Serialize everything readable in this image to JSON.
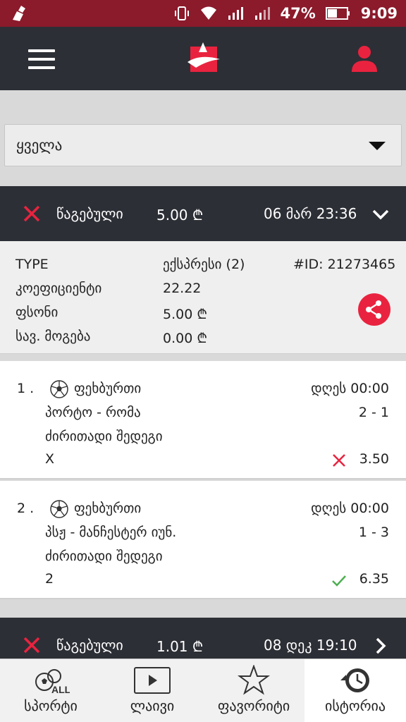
{
  "status_bar": {
    "battery": "47%",
    "time": "9:09"
  },
  "filter": {
    "value": "ყველა"
  },
  "ticket1": {
    "status": "წაგებული",
    "amount": "5.00 ₾",
    "date": "06 მარ 23:36",
    "details": {
      "type_label": "TYPE",
      "type_value": "ექსპრესი (2)",
      "id": "#ID: 21273465",
      "coef_label": "კოეფიციენტი",
      "coef_value": "22.22",
      "stake_label": "ფსონი",
      "stake_value": "5.00 ₾",
      "win_label": "სავ. მოგება",
      "win_value": "0.00 ₾"
    },
    "selections": [
      {
        "num": "1 .",
        "sport": "ფეხბურთი",
        "time": "დღეს 00:00",
        "match": "პორტო - რომა",
        "score": "2 - 1",
        "market": "ძირითადი შედეგი",
        "pick": "X",
        "result": "lost",
        "odd": "3.50"
      },
      {
        "num": "2 .",
        "sport": "ფეხბურთი",
        "time": "დღეს 00:00",
        "match": "პსჟ - მანჩესტერ იუნ.",
        "score": "1 - 3",
        "market": "ძირითადი შედეგი",
        "pick": "2",
        "result": "won",
        "odd": "6.35"
      }
    ]
  },
  "ticket2": {
    "status": "წაგებული",
    "amount": "1.01 ₾",
    "date": "08 დეკ 19:10"
  },
  "bottom_nav": [
    {
      "label": "სპორტი",
      "icon": "sports-all-icon",
      "badge": "ALL"
    },
    {
      "label": "ლაივი",
      "icon": "play-icon"
    },
    {
      "label": "ფავორიტი",
      "icon": "star-icon"
    },
    {
      "label": "ისტორია",
      "icon": "history-icon",
      "active": true
    }
  ],
  "colors": {
    "header": "#2d2f36",
    "statusbar": "#8b1a2b",
    "accent": "#e9233f",
    "win": "#4caf50"
  }
}
